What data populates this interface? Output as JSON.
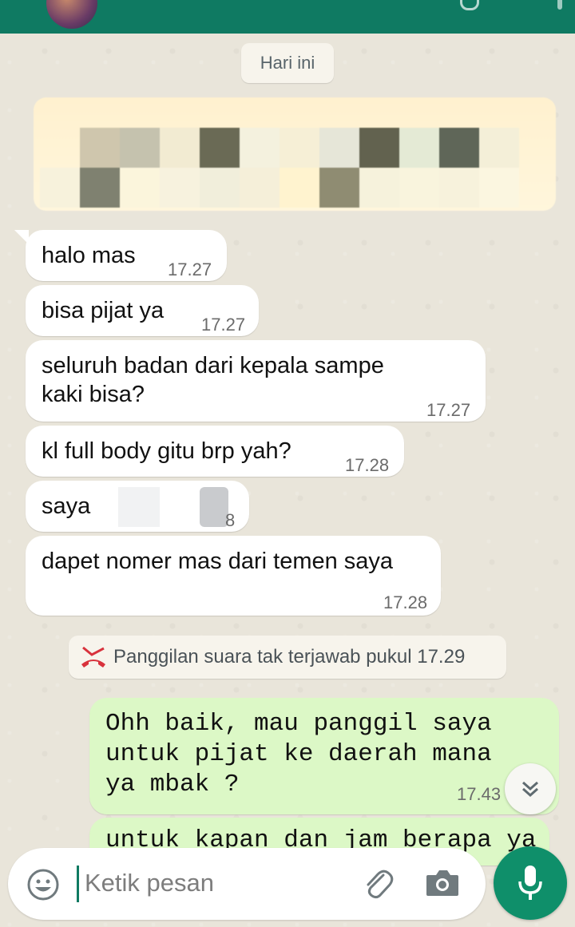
{
  "date_chip": "Hari ini",
  "messages_in": [
    {
      "text": "halo mas",
      "time": "17.27"
    },
    {
      "text": "bisa pijat ya",
      "time": "17.27"
    },
    {
      "text": "seluruh badan dari kepala sampe",
      "text2": "kaki bisa?",
      "time": "17.27"
    },
    {
      "text": "kl full body gitu brp yah?",
      "time": "17.28"
    },
    {
      "text": "saya",
      "time": "8"
    },
    {
      "text": "dapet nomer mas dari temen saya",
      "time": "17.28"
    }
  ],
  "missed_call": "Panggilan suara tak terjawab pukul 17.29",
  "messages_out": [
    {
      "line1": "Ohh baik, mau panggil saya",
      "line2": "untuk pijat ke daerah mana",
      "line3": "ya mbak ?",
      "time": "17.43"
    },
    {
      "line1": "untuk kapan dan jam berapa ya mbak"
    }
  ],
  "composer": {
    "placeholder": "Ketik pesan"
  },
  "icons": {
    "emoji": "emoji-icon",
    "attach": "paperclip-icon",
    "camera": "camera-icon",
    "mic": "microphone-icon",
    "missed_call": "missed-call-icon",
    "scroll": "double-chevron-down-icon"
  },
  "colors": {
    "header": "#0f7a62",
    "outgoing_bubble": "#dcf8c6",
    "missed_call_red": "#d8323c",
    "mic_button": "#0f8f6a"
  }
}
